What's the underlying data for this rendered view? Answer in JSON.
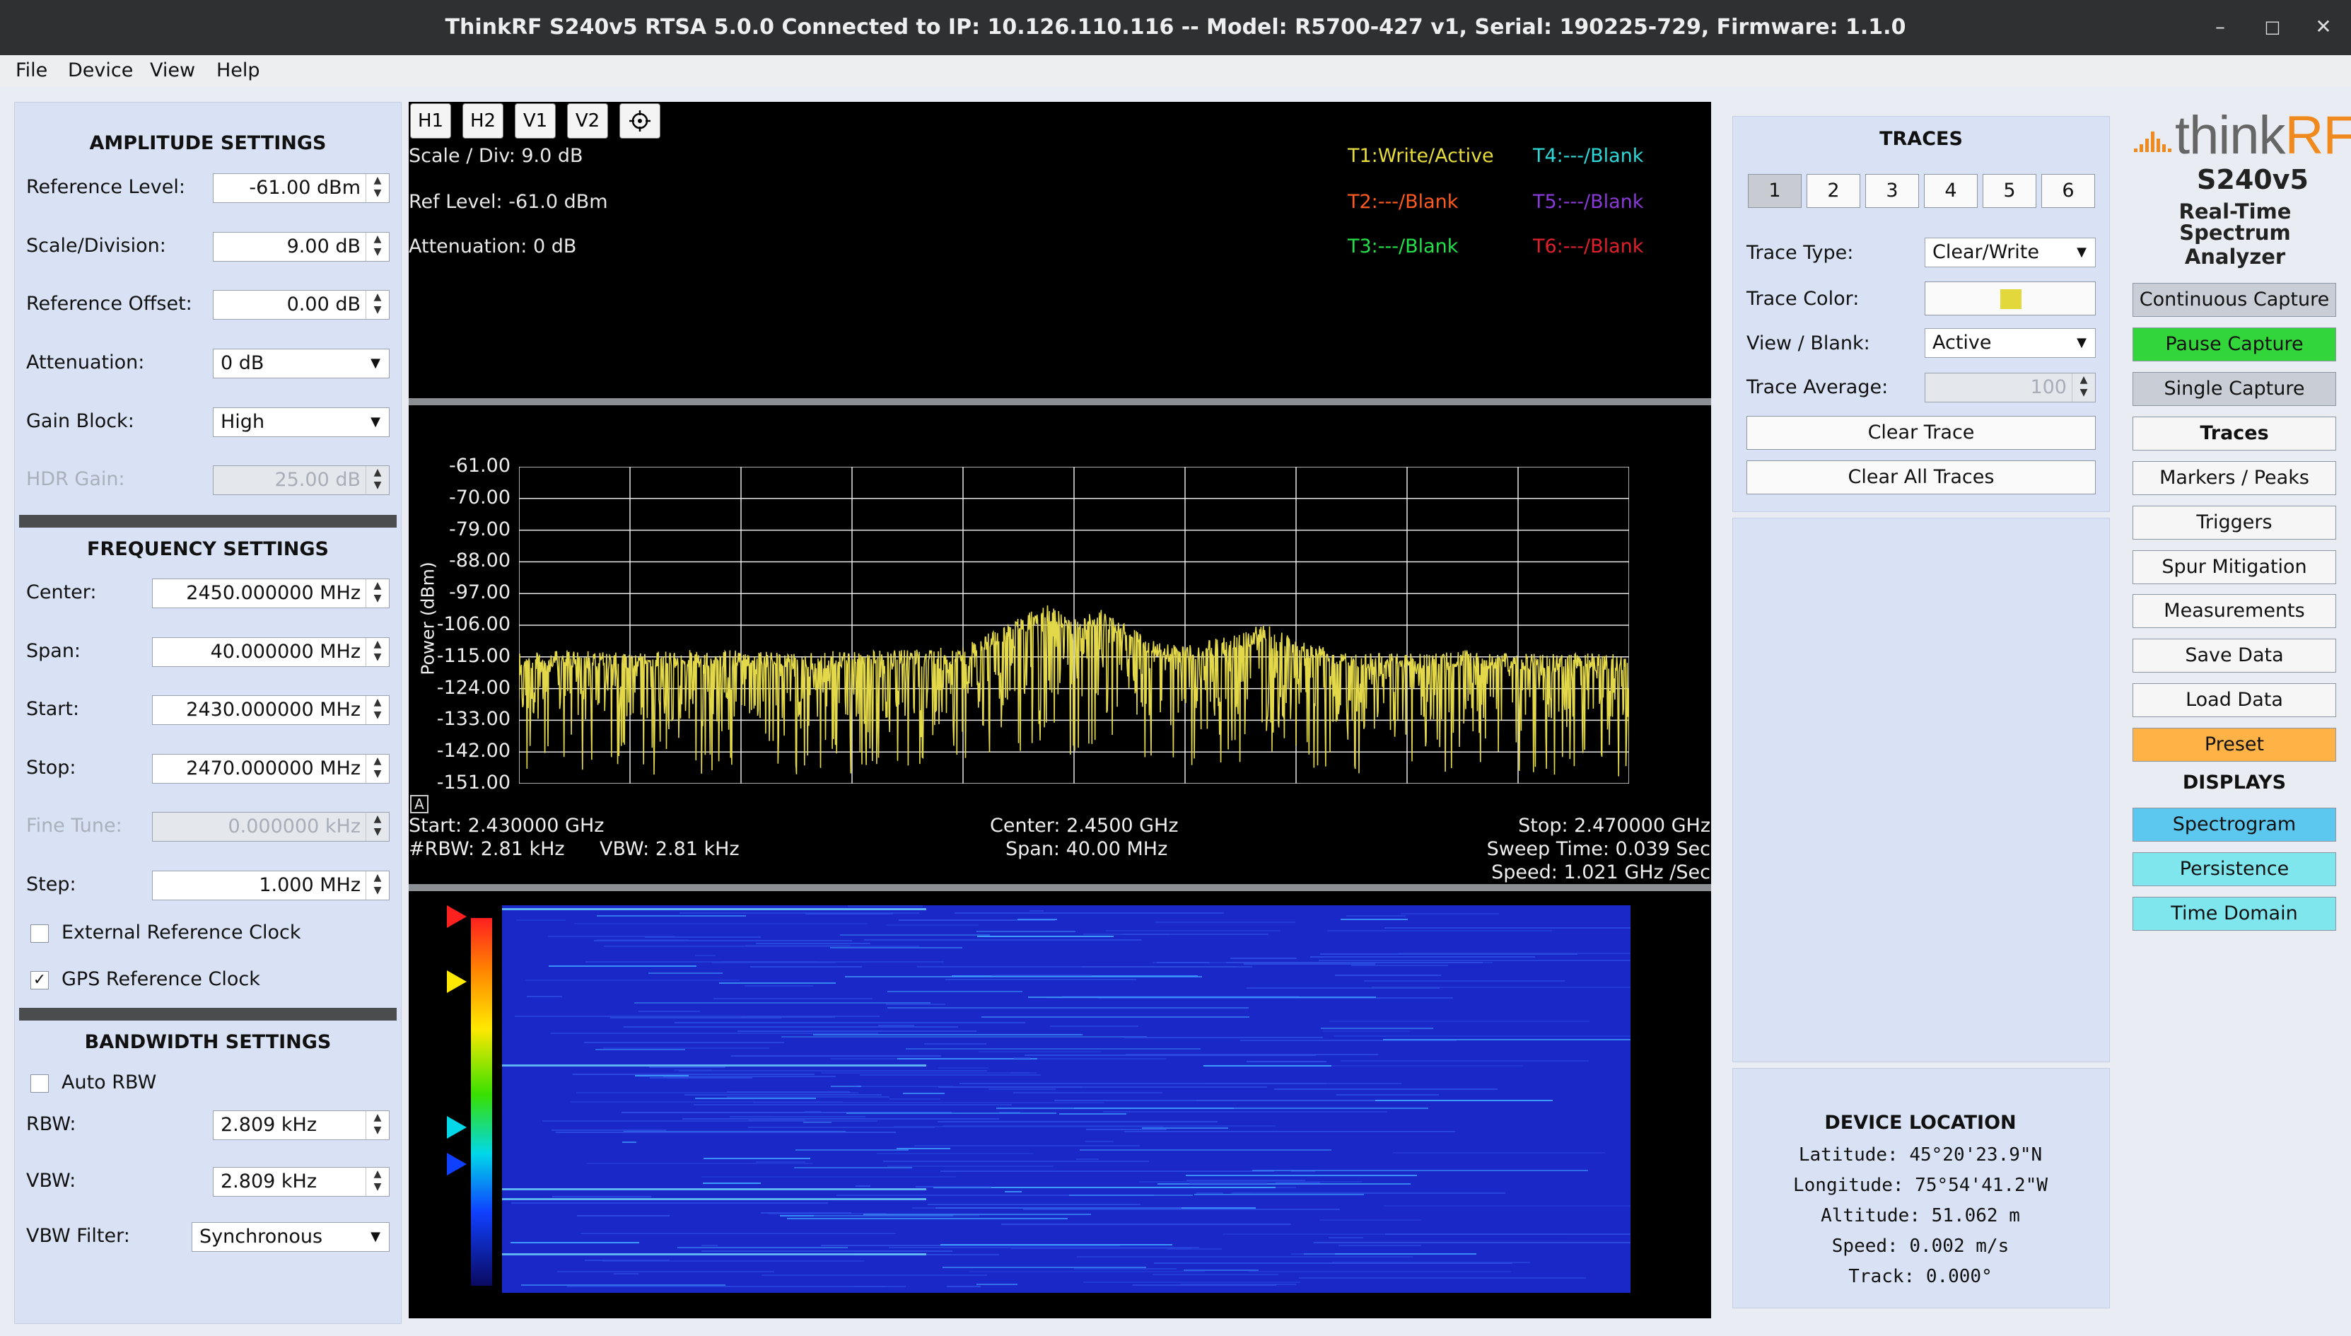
{
  "window": {
    "title": "ThinkRF S240v5 RTSA 5.0.0 Connected to IP: 10.126.110.116 -- Model: R5700-427 v1, Serial: 190225-729, Firmware: 1.1.0",
    "minimize": "–",
    "maximize": "□",
    "close": "✕"
  },
  "menu": [
    "File",
    "Device",
    "View",
    "Help"
  ],
  "amplitude": {
    "title": "AMPLITUDE SETTINGS",
    "ref_level_label": "Reference Level:",
    "ref_level": "-61.00 dBm",
    "scale_label": "Scale/Division:",
    "scale": "9.00 dB",
    "ref_offset_label": "Reference Offset:",
    "ref_offset": "0.00 dB",
    "atten_label": "Attenuation:",
    "atten": "0 dB",
    "gain_label": "Gain Block:",
    "gain": "High",
    "hdr_label": "HDR Gain:",
    "hdr": "25.00 dB"
  },
  "frequency": {
    "title": "FREQUENCY SETTINGS",
    "center_label": "Center:",
    "center": "2450.000000 MHz",
    "span_label": "Span:",
    "span": "40.000000 MHz",
    "start_label": "Start:",
    "start": "2430.000000 MHz",
    "stop_label": "Stop:",
    "stop": "2470.000000 MHz",
    "fine_label": "Fine Tune:",
    "fine": "0.000000 kHz",
    "step_label": "Step:",
    "step": "1.000 MHz",
    "ext_clock_label": "External Reference Clock",
    "gps_clock_label": "GPS Reference Clock",
    "gps_check": "✓"
  },
  "bandwidth": {
    "title": "BANDWIDTH SETTINGS",
    "auto_rbw_label": "Auto RBW",
    "rbw_label": "RBW:",
    "rbw": "2.809 kHz",
    "vbw_label": "VBW:",
    "vbw": "2.809 kHz",
    "vbw_filter_label": "VBW Filter:",
    "vbw_filter": "Synchronous"
  },
  "toolbar": [
    "H1",
    "H2",
    "V1",
    "V2"
  ],
  "graph_info": {
    "scale": "Scale / Div: 9.0 dB",
    "ref": "Ref Level: -61.0 dBm",
    "atten": "Attenuation: 0 dB"
  },
  "trace_labels": [
    {
      "text": "T1:Write/Active",
      "color": "#e6dc3a"
    },
    {
      "text": "T2:---/Blank",
      "color": "#ff5a1e"
    },
    {
      "text": "T3:---/Blank",
      "color": "#22e04a"
    },
    {
      "text": "T4:---/Blank",
      "color": "#2fd8d8"
    },
    {
      "text": "T5:---/Blank",
      "color": "#8a3ad8"
    },
    {
      "text": "T6:---/Blank",
      "color": "#e0202a"
    }
  ],
  "chart_data": {
    "type": "line",
    "ylabel": "Power (dBm)",
    "y_ticks": [
      "-61.00",
      "-70.00",
      "-79.00",
      "-88.00",
      "-97.00",
      "-106.00",
      "-115.00",
      "-124.00",
      "-133.00",
      "-142.00",
      "-151.00"
    ],
    "ylim": [
      -151,
      -61
    ],
    "xlim_mhz": [
      2430,
      2470
    ],
    "grid": true,
    "series_color": "#e2d84a",
    "series": [
      {
        "x_mhz": [
          2430,
          2432,
          2434,
          2436,
          2438,
          2440,
          2442,
          2444,
          2446,
          2447,
          2448,
          2449,
          2450,
          2451,
          2452,
          2453,
          2454,
          2456,
          2457,
          2458,
          2460,
          2462,
          2464,
          2466,
          2468,
          2470
        ],
        "peak_dbm": [
          -114,
          -113,
          -114,
          -113,
          -113,
          -114,
          -113,
          -113,
          -112,
          -108,
          -104,
          -100,
          -104,
          -101,
          -106,
          -111,
          -112,
          -108,
          -105,
          -110,
          -113,
          -114,
          -113,
          -114,
          -114,
          -114
        ],
        "floor_dbm": [
          -133,
          -132,
          -133,
          -133,
          -132,
          -133,
          -133,
          -132,
          -131,
          -128,
          -127,
          -125,
          -128,
          -126,
          -129,
          -131,
          -131,
          -129,
          -128,
          -130,
          -133,
          -133,
          -133,
          -133,
          -133,
          -133
        ]
      }
    ],
    "marker_label": "A"
  },
  "status": {
    "start": "Start: 2.430000 GHz",
    "rbw": "#RBW: 2.81 kHz",
    "vbw": "VBW: 2.81 kHz",
    "center": "Center: 2.4500 GHz",
    "span": "Span: 40.00 MHz",
    "stop": "Stop: 2.470000 GHz",
    "sweep": "Sweep Time: 0.039 Sec",
    "speed": "Speed: 1.021 GHz /Sec"
  },
  "traces_panel": {
    "title": "TRACES",
    "buttons": [
      "1",
      "2",
      "3",
      "4",
      "5",
      "6"
    ],
    "type_label": "Trace Type:",
    "type": "Clear/Write",
    "color_label": "Trace Color:",
    "color": "#e2d83c",
    "view_label": "View / Blank:",
    "view": "Active",
    "avg_label": "Trace Average:",
    "avg": "100",
    "clear_trace": "Clear Trace",
    "clear_all": "Clear All Traces"
  },
  "location": {
    "title": "DEVICE LOCATION",
    "lat": "Latitude: 45°20'23.9\"N",
    "lon": "Longitude: 75°54'41.2\"W",
    "alt": "Altitude: 51.062 m",
    "speed": "Speed: 0.002 m/s",
    "track": "Track: 0.000°"
  },
  "brand": {
    "name": "thinkRF",
    "model": "S240v5",
    "line1": "Real-Time",
    "line2": "Spectrum Analyzer"
  },
  "right_buttons": {
    "continuous": "Continuous Capture",
    "pause": "Pause Capture",
    "single": "Single Capture",
    "traces": "Traces",
    "markers": "Markers / Peaks",
    "triggers": "Triggers",
    "spur": "Spur Mitigation",
    "measurements": "Measurements",
    "save": "Save Data",
    "load": "Load Data",
    "preset": "Preset",
    "displays_title": "DISPLAYS",
    "spectrogram": "Spectrogram",
    "persistence": "Persistence",
    "time_domain": "Time Domain"
  },
  "colors": {
    "accent_green": "#33d63a",
    "accent_orange": "#ffb347",
    "accent_cyan": "#7fe6ee",
    "panel": "#d8e2f4"
  }
}
